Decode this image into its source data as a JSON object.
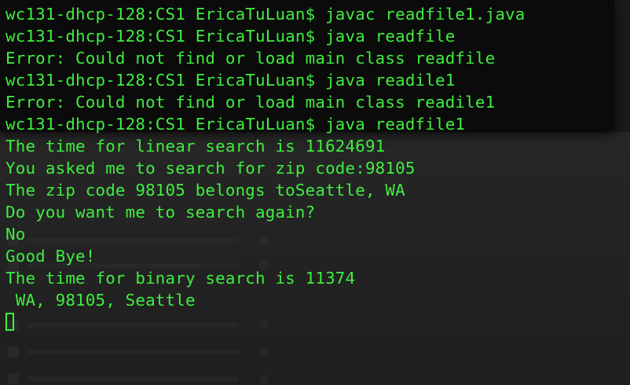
{
  "terminal": {
    "lines": [
      "wc131-dhcp-128:CS1 EricaTuLuan$ javac readfile1.java",
      "wc131-dhcp-128:CS1 EricaTuLuan$ java readfile",
      "Error: Could not find or load main class readfile",
      "wc131-dhcp-128:CS1 EricaTuLuan$ java readile1",
      "Error: Could not find or load main class readile1",
      "wc131-dhcp-128:CS1 EricaTuLuan$ java readfile1",
      "The time for linear search is 11624691",
      "You asked me to search for zip code:98105",
      "The zip code 98105 belongs toSeattle, WA",
      "Do you want me to search again?",
      "No",
      "Good Bye!",
      "The time for binary search is 11374",
      " WA, 98105, Seattle"
    ]
  },
  "colors": {
    "text": "#3fee3f",
    "background": "#1a1a1a"
  }
}
